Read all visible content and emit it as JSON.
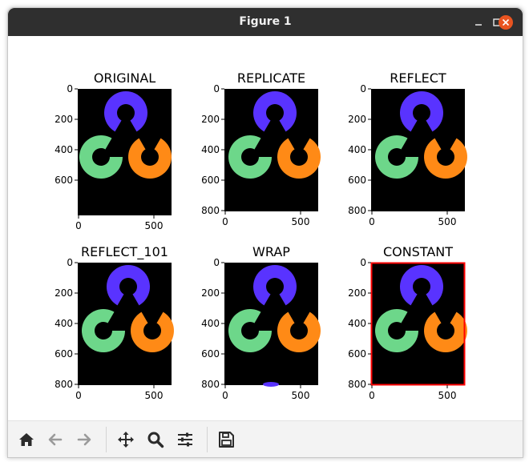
{
  "window": {
    "title": "Figure 1"
  },
  "colors": {
    "red": "#5933ff",
    "green": "#6dd78a",
    "blue": "#ff8a16",
    "constant_border": "#ff0000"
  },
  "subplots": [
    {
      "title": "ORIGINAL",
      "yticks": [
        "0",
        "200",
        "400",
        "600"
      ],
      "xticks": [
        "0",
        "500"
      ]
    },
    {
      "title": "REPLICATE",
      "yticks": [
        "0",
        "200",
        "400",
        "600",
        "800"
      ],
      "xticks": [
        "0",
        "500"
      ]
    },
    {
      "title": "REFLECT",
      "yticks": [
        "0",
        "200",
        "400",
        "600",
        "800"
      ],
      "xticks": [
        "0",
        "500"
      ]
    },
    {
      "title": "REFLECT_101",
      "yticks": [
        "0",
        "200",
        "400",
        "600",
        "800"
      ],
      "xticks": [
        "0",
        "500"
      ]
    },
    {
      "title": "WRAP",
      "yticks": [
        "0",
        "200",
        "400",
        "600",
        "800"
      ],
      "xticks": [
        "0",
        "500"
      ]
    },
    {
      "title": "CONSTANT",
      "yticks": [
        "0",
        "200",
        "400",
        "600",
        "800"
      ],
      "xticks": [
        "0",
        "500"
      ]
    }
  ],
  "toolbar": {
    "home": "home-icon",
    "back": "back-arrow-icon",
    "forward": "forward-arrow-icon",
    "pan": "move-icon",
    "zoom": "magnifier-icon",
    "configure": "sliders-icon",
    "save": "floppy-icon"
  }
}
